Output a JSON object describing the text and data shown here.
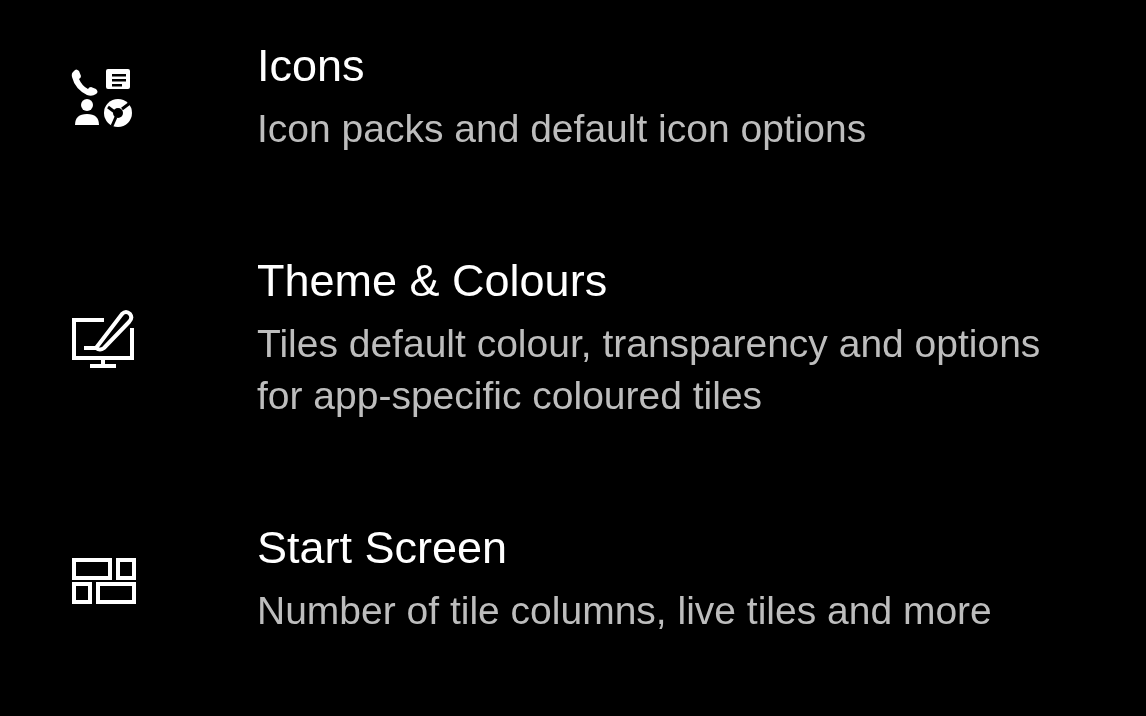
{
  "settings": [
    {
      "kind": "apps",
      "title": "Icons",
      "subtitle": "Icon packs and default icon options"
    },
    {
      "kind": "theme",
      "title": "Theme & Colours",
      "subtitle": "Tiles default colour, transparency and options for app-specific coloured tiles"
    },
    {
      "kind": "tiles",
      "title": "Start Screen",
      "subtitle": "Number of tile columns, live tiles and more"
    }
  ]
}
